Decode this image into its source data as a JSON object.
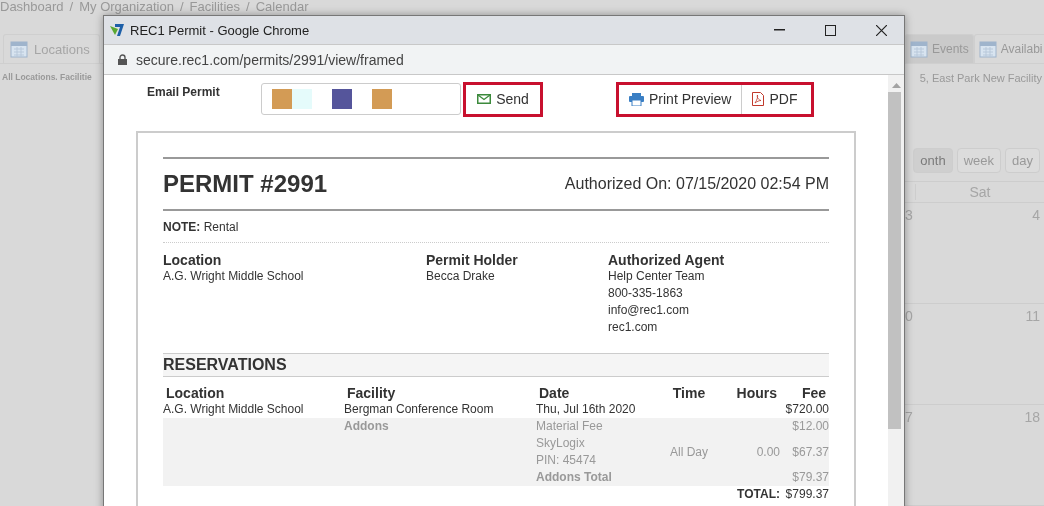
{
  "background": {
    "breadcrumb": {
      "separator": "/",
      "items": [
        "Dashboard",
        "My Organization",
        "Facilities",
        "Calendar"
      ]
    },
    "tabs_left": [
      {
        "label": "Locations",
        "selected": false
      }
    ],
    "tabs_right": [
      {
        "label": "Events",
        "selected": true
      },
      {
        "label": "Availabi",
        "selected": false
      }
    ],
    "filter_left": "All Locations. Facilitie",
    "filter_right": "5, East Park New Facility",
    "view_buttons": [
      {
        "label": "onth",
        "selected": true
      },
      {
        "label": "week",
        "selected": false
      },
      {
        "label": "day",
        "selected": false
      }
    ],
    "calendar": {
      "columns": [
        "Sat"
      ],
      "weeks": [
        [
          "3",
          "4"
        ],
        [
          "0",
          "11"
        ],
        [
          "7",
          "18"
        ]
      ]
    }
  },
  "popup": {
    "title": "REC1 Permit - Google Chrome",
    "url": "secure.rec1.com/permits/2991/view/framed",
    "email": {
      "label": "Email Permit",
      "blocks": [
        {
          "color": "#d39b55"
        },
        {
          "color": "#e5fbfb"
        },
        {
          "color": "#55559b"
        },
        {
          "color": "#d39b55"
        }
      ],
      "send": "Send"
    },
    "print_preview": "Print Preview",
    "pdf": "PDF",
    "permit": {
      "title": "PERMIT #2991",
      "authorized_on": "Authorized On: 07/15/2020 02:54 PM",
      "note": "**NOTE:** Rental",
      "info": [
        {
          "heading": "Location",
          "lines": [
            "A.G. Wright Middle School"
          ]
        },
        {
          "heading": "Permit Holder",
          "lines": [
            "Becca Drake"
          ]
        },
        {
          "heading": "Authorized Agent",
          "lines": [
            "Help Center Team",
            "800-335-1863",
            "info@rec1.com",
            "rec1.com"
          ]
        }
      ],
      "reservations": {
        "title": "RESERVATIONS",
        "columns": [
          "Location",
          "Facility",
          "Date",
          "Time",
          "Hours",
          "Fee"
        ],
        "rows": [
          {
            "location": "A.G. Wright Middle School",
            "facility": "Bergman Conference Room",
            "date": "Thu, Jul 16th 2020",
            "fee": "$720.00"
          }
        ],
        "addons": {
          "label": "Addons",
          "items": [
            {
              "lines": [
                "Material Fee"
              ],
              "fee": "$12.00"
            },
            {
              "lines": [
                "SkyLogix",
                "PIN: 45474"
              ],
              "time": "All Day",
              "hours": "0.00",
              "fee": "$67.37"
            }
          ],
          "total_label": "Addons Total",
          "total": "$79.37"
        },
        "total_label": "TOTAL:",
        "total": "$799.37"
      }
    }
  }
}
